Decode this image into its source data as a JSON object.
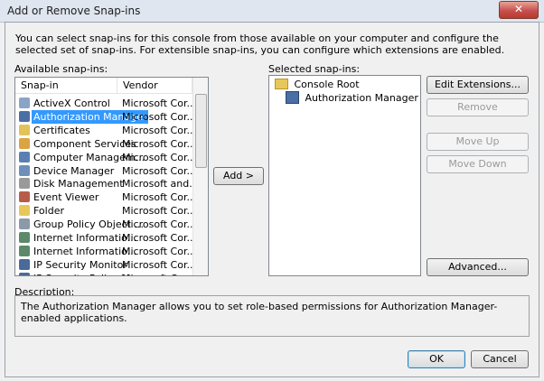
{
  "window": {
    "title": "Add or Remove Snap-ins",
    "close_label": "✕"
  },
  "intro": "You can select snap-ins for this console from those available on your computer and configure the selected set of snap-ins. For extensible snap-ins, you can configure which extensions are enabled.",
  "available": {
    "label": "Available snap-ins:",
    "columns": {
      "snapin": "Snap-in",
      "vendor": "Vendor"
    },
    "items": [
      {
        "name": "ActiveX Control",
        "vendor": "Microsoft Cor...",
        "icon": "activex-icon",
        "color": "#8aa4c8"
      },
      {
        "name": "Authorization Manager",
        "vendor": "Microsoft Cor...",
        "icon": "authorization-manager-icon",
        "color": "#4a6fa5",
        "selected": true
      },
      {
        "name": "Certificates",
        "vendor": "Microsoft Cor...",
        "icon": "certificates-icon",
        "color": "#e2c35a"
      },
      {
        "name": "Component Services",
        "vendor": "Microsoft Cor...",
        "icon": "component-services-icon",
        "color": "#d9a441"
      },
      {
        "name": "Computer Managem...",
        "vendor": "Microsoft Cor...",
        "icon": "computer-management-icon",
        "color": "#5b7fb3"
      },
      {
        "name": "Device Manager",
        "vendor": "Microsoft Cor...",
        "icon": "device-manager-icon",
        "color": "#6e8fb8"
      },
      {
        "name": "Disk Management",
        "vendor": "Microsoft and...",
        "icon": "disk-management-icon",
        "color": "#9a9a9a"
      },
      {
        "name": "Event Viewer",
        "vendor": "Microsoft Cor...",
        "icon": "event-viewer-icon",
        "color": "#b85c4a"
      },
      {
        "name": "Folder",
        "vendor": "Microsoft Cor...",
        "icon": "folder-icon",
        "color": "#e8c75a"
      },
      {
        "name": "Group Policy Object ...",
        "vendor": "Microsoft Cor...",
        "icon": "group-policy-icon",
        "color": "#8a9aa8"
      },
      {
        "name": "Internet Informatio...",
        "vendor": "Microsoft Cor...",
        "icon": "iis-icon",
        "color": "#5a8a6a"
      },
      {
        "name": "Internet Informatio...",
        "vendor": "Microsoft Cor...",
        "icon": "iis-icon",
        "color": "#5a8a6a"
      },
      {
        "name": "IP Security Monitor",
        "vendor": "Microsoft Cor...",
        "icon": "ip-security-monitor-icon",
        "color": "#4a6a9a"
      },
      {
        "name": "IP Security Policy M...",
        "vendor": "Microsoft Cor...",
        "icon": "ip-security-policy-icon",
        "color": "#4a6a9a"
      }
    ]
  },
  "add_button": "Add >",
  "selected": {
    "label": "Selected snap-ins:",
    "root": "Console Root",
    "children": [
      "Authorization Manager"
    ]
  },
  "buttons": {
    "edit_extensions": "Edit Extensions...",
    "remove": "Remove",
    "move_up": "Move Up",
    "move_down": "Move Down",
    "advanced": "Advanced...",
    "ok": "OK",
    "cancel": "Cancel"
  },
  "description": {
    "label": "Description:",
    "text": "The Authorization Manager allows you to set role-based permissions for Authorization Manager-enabled applications."
  }
}
